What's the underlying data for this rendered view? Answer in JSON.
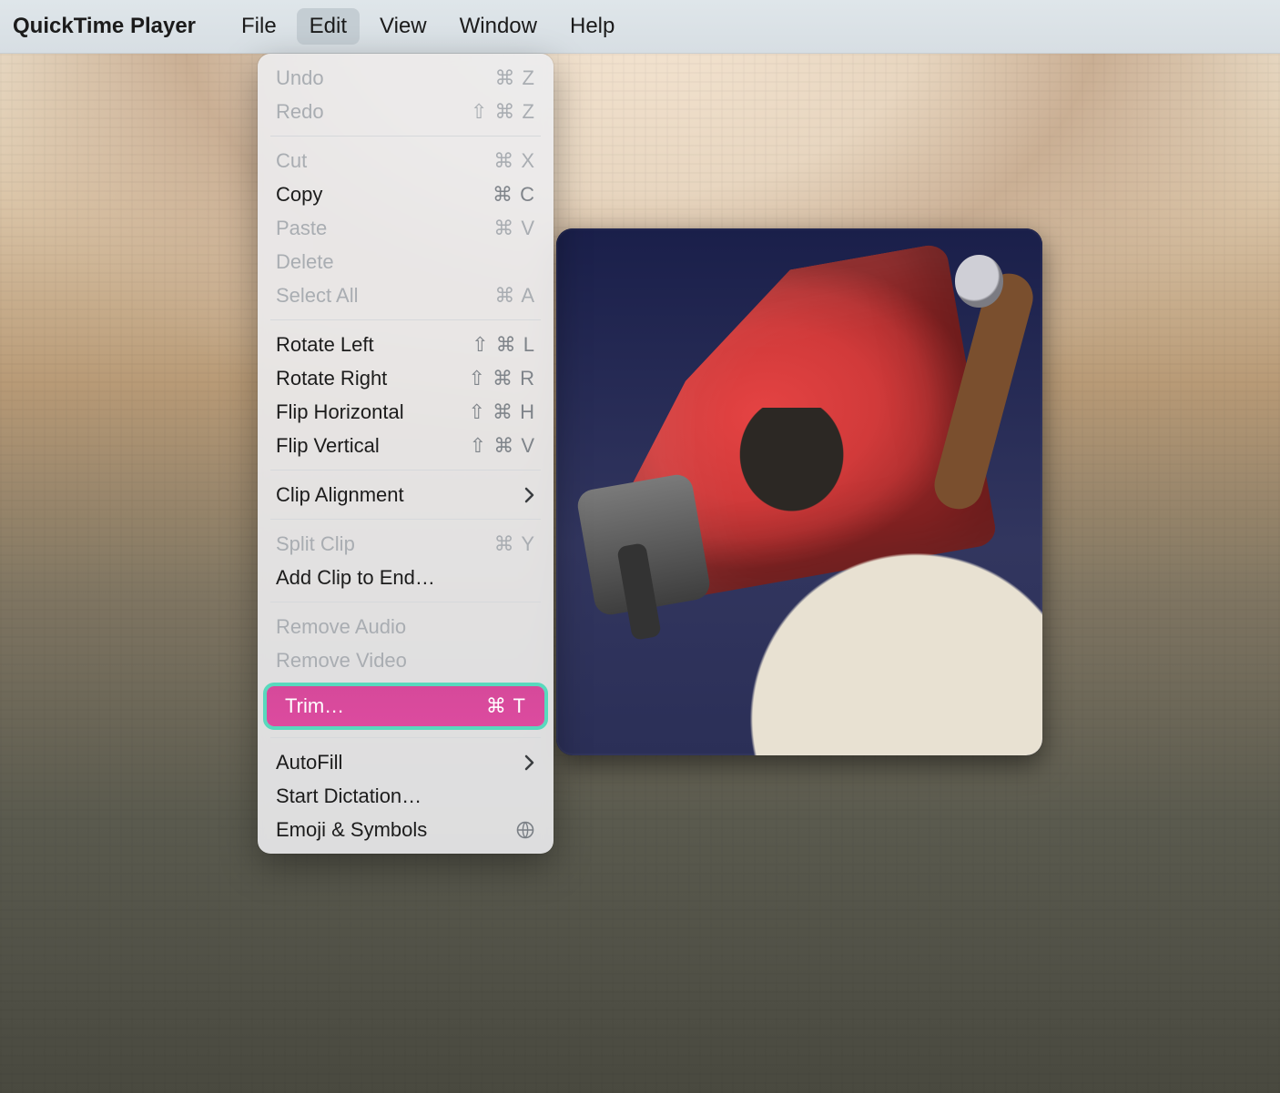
{
  "menubar": {
    "app": "QuickTime Player",
    "items": [
      {
        "label": "File"
      },
      {
        "label": "Edit",
        "selected": true
      },
      {
        "label": "View"
      },
      {
        "label": "Window"
      },
      {
        "label": "Help"
      }
    ]
  },
  "edit_menu": {
    "undo": {
      "label": "Undo",
      "shortcut": "⌘ Z",
      "enabled": false
    },
    "redo": {
      "label": "Redo",
      "shortcut": "⇧ ⌘ Z",
      "enabled": false
    },
    "cut": {
      "label": "Cut",
      "shortcut": "⌘ X",
      "enabled": false
    },
    "copy": {
      "label": "Copy",
      "shortcut": "⌘ C",
      "enabled": true
    },
    "paste": {
      "label": "Paste",
      "shortcut": "⌘ V",
      "enabled": false
    },
    "delete": {
      "label": "Delete",
      "shortcut": "",
      "enabled": false
    },
    "select_all": {
      "label": "Select All",
      "shortcut": "⌘ A",
      "enabled": false
    },
    "rotate_left": {
      "label": "Rotate Left",
      "shortcut": "⇧ ⌘ L",
      "enabled": true
    },
    "rotate_right": {
      "label": "Rotate Right",
      "shortcut": "⇧ ⌘ R",
      "enabled": true
    },
    "flip_horizontal": {
      "label": "Flip Horizontal",
      "shortcut": "⇧ ⌘ H",
      "enabled": true
    },
    "flip_vertical": {
      "label": "Flip Vertical",
      "shortcut": "⇧ ⌘ V",
      "enabled": true
    },
    "clip_alignment": {
      "label": "Clip Alignment",
      "submenu": true,
      "enabled": true
    },
    "split_clip": {
      "label": "Split Clip",
      "shortcut": "⌘ Y",
      "enabled": false
    },
    "add_clip": {
      "label": "Add Clip to End…",
      "shortcut": "",
      "enabled": true
    },
    "remove_audio": {
      "label": "Remove Audio",
      "shortcut": "",
      "enabled": false
    },
    "remove_video": {
      "label": "Remove Video",
      "shortcut": "",
      "enabled": false
    },
    "trim": {
      "label": "Trim…",
      "shortcut": "⌘ T",
      "enabled": true,
      "highlighted": true
    },
    "autofill": {
      "label": "AutoFill",
      "submenu": true,
      "enabled": true
    },
    "start_dictation": {
      "label": "Start Dictation…",
      "shortcut": "",
      "enabled": true
    },
    "emoji_symbols": {
      "label": "Emoji & Symbols",
      "globe": true,
      "enabled": true
    }
  },
  "colors": {
    "highlight_bg": "#d6499a",
    "highlight_border": "#58d9bd"
  }
}
